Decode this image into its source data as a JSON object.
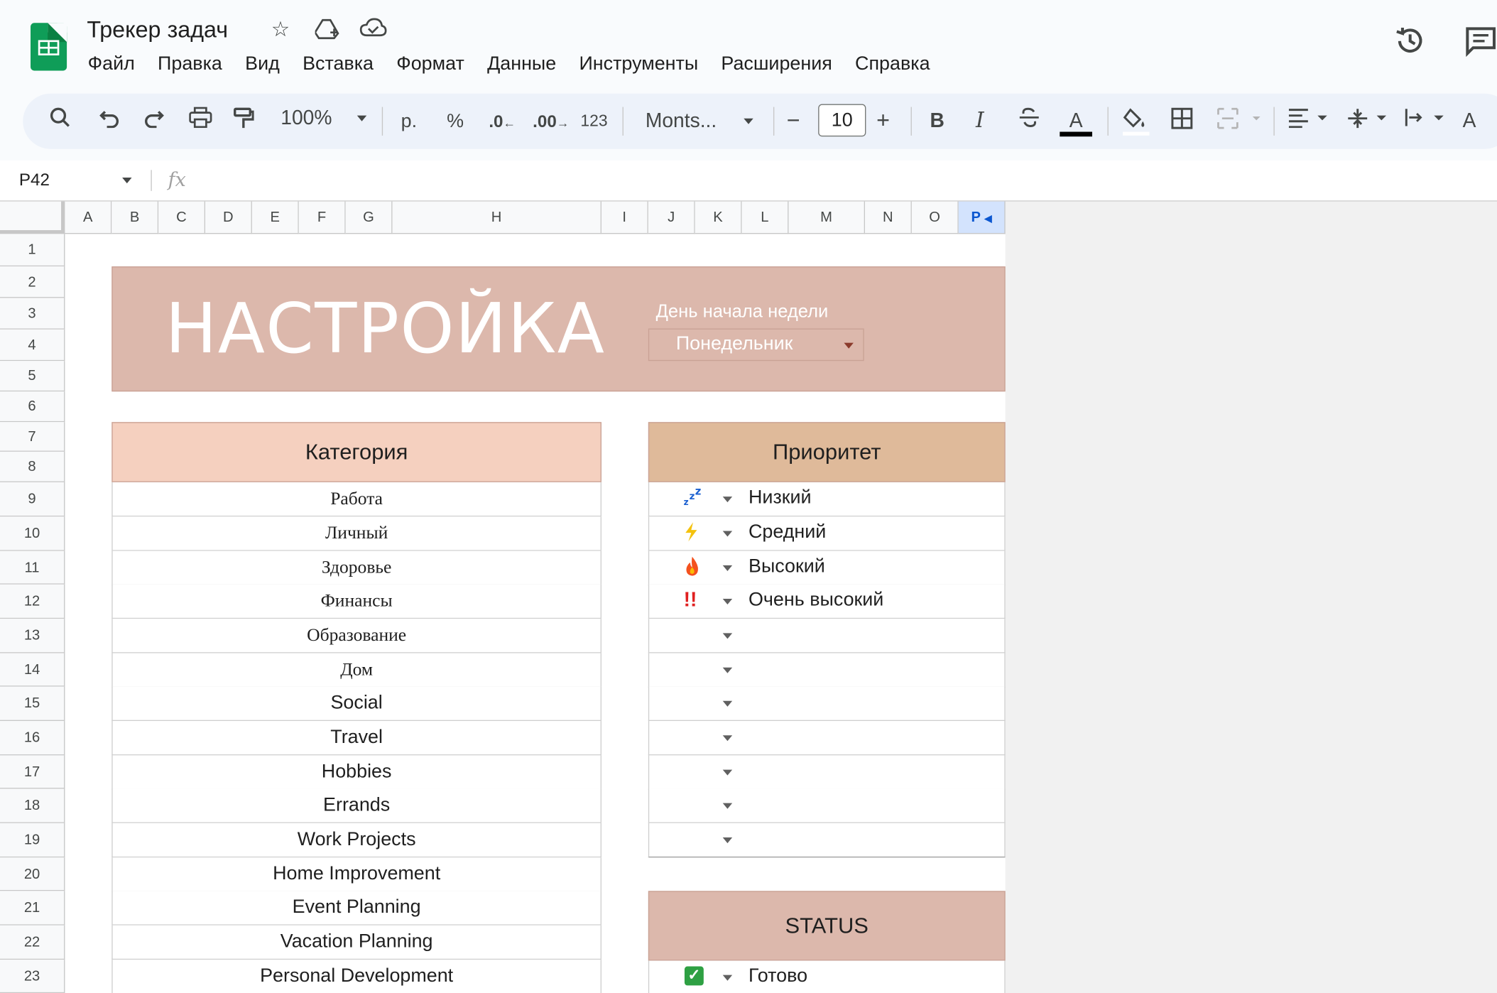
{
  "doc": {
    "title": "Трекер задач"
  },
  "menu": [
    "Файл",
    "Правка",
    "Вид",
    "Вставка",
    "Формат",
    "Данные",
    "Инструменты",
    "Расширения",
    "Справка"
  ],
  "toolbar": {
    "zoom": "100%",
    "currency": "р.",
    "percent": "%",
    "decrease_decimals": ".0",
    "increase_decimals": ".00",
    "number_format": "123",
    "font": "Monts...",
    "font_size": "10",
    "bold": "B",
    "italic": "I",
    "text_color_glyph": "A",
    "rotate_glyph": "A"
  },
  "formula_bar": {
    "name_box": "P42",
    "fx": "fx"
  },
  "columns": [
    "A",
    "B",
    "C",
    "D",
    "E",
    "F",
    "G",
    "H",
    "I",
    "J",
    "K",
    "L",
    "M",
    "N",
    "O",
    "P"
  ],
  "selected_column": "P",
  "rows": [
    "1",
    "2",
    "3",
    "4",
    "5",
    "6",
    "7",
    "8",
    "9",
    "10",
    "11",
    "12",
    "13",
    "14",
    "15",
    "16",
    "17",
    "18",
    "19",
    "20",
    "21",
    "22",
    "23"
  ],
  "setup": {
    "title": "НАСТРОЙКА",
    "week_start_label": "День начала недели",
    "week_start_value": "Понедельник"
  },
  "category": {
    "header": "Категория",
    "items": [
      "Работа",
      "Личный",
      "Здоровье",
      "Финансы",
      "Образование",
      "Дом",
      "Social",
      "Travel",
      "Hobbies",
      "Errands",
      "Work Projects",
      "Home Improvement",
      "Event Planning",
      "Vacation Planning",
      "Personal Development"
    ]
  },
  "priority": {
    "header": "Приоритет",
    "items": [
      {
        "emoji": "💤",
        "label": "Низкий"
      },
      {
        "emoji": "⚡",
        "label": "Средний"
      },
      {
        "emoji": "🔥",
        "label": "Высокий"
      },
      {
        "emoji": "‼️",
        "label": "Очень высокий"
      },
      {
        "emoji": "",
        "label": ""
      },
      {
        "emoji": "",
        "label": ""
      },
      {
        "emoji": "",
        "label": ""
      },
      {
        "emoji": "",
        "label": ""
      },
      {
        "emoji": "",
        "label": ""
      },
      {
        "emoji": "",
        "label": ""
      },
      {
        "emoji": "",
        "label": ""
      }
    ]
  },
  "status": {
    "header": "STATUS",
    "items": [
      {
        "icon": "✓",
        "label": "Готово"
      }
    ]
  },
  "colors": {
    "banner": "#dcb8ac",
    "category_header": "#f5d0bf",
    "priority_header": "#dfba9a",
    "sheets_green": "#0f9d58",
    "selected_col": "#d3e3fd"
  }
}
